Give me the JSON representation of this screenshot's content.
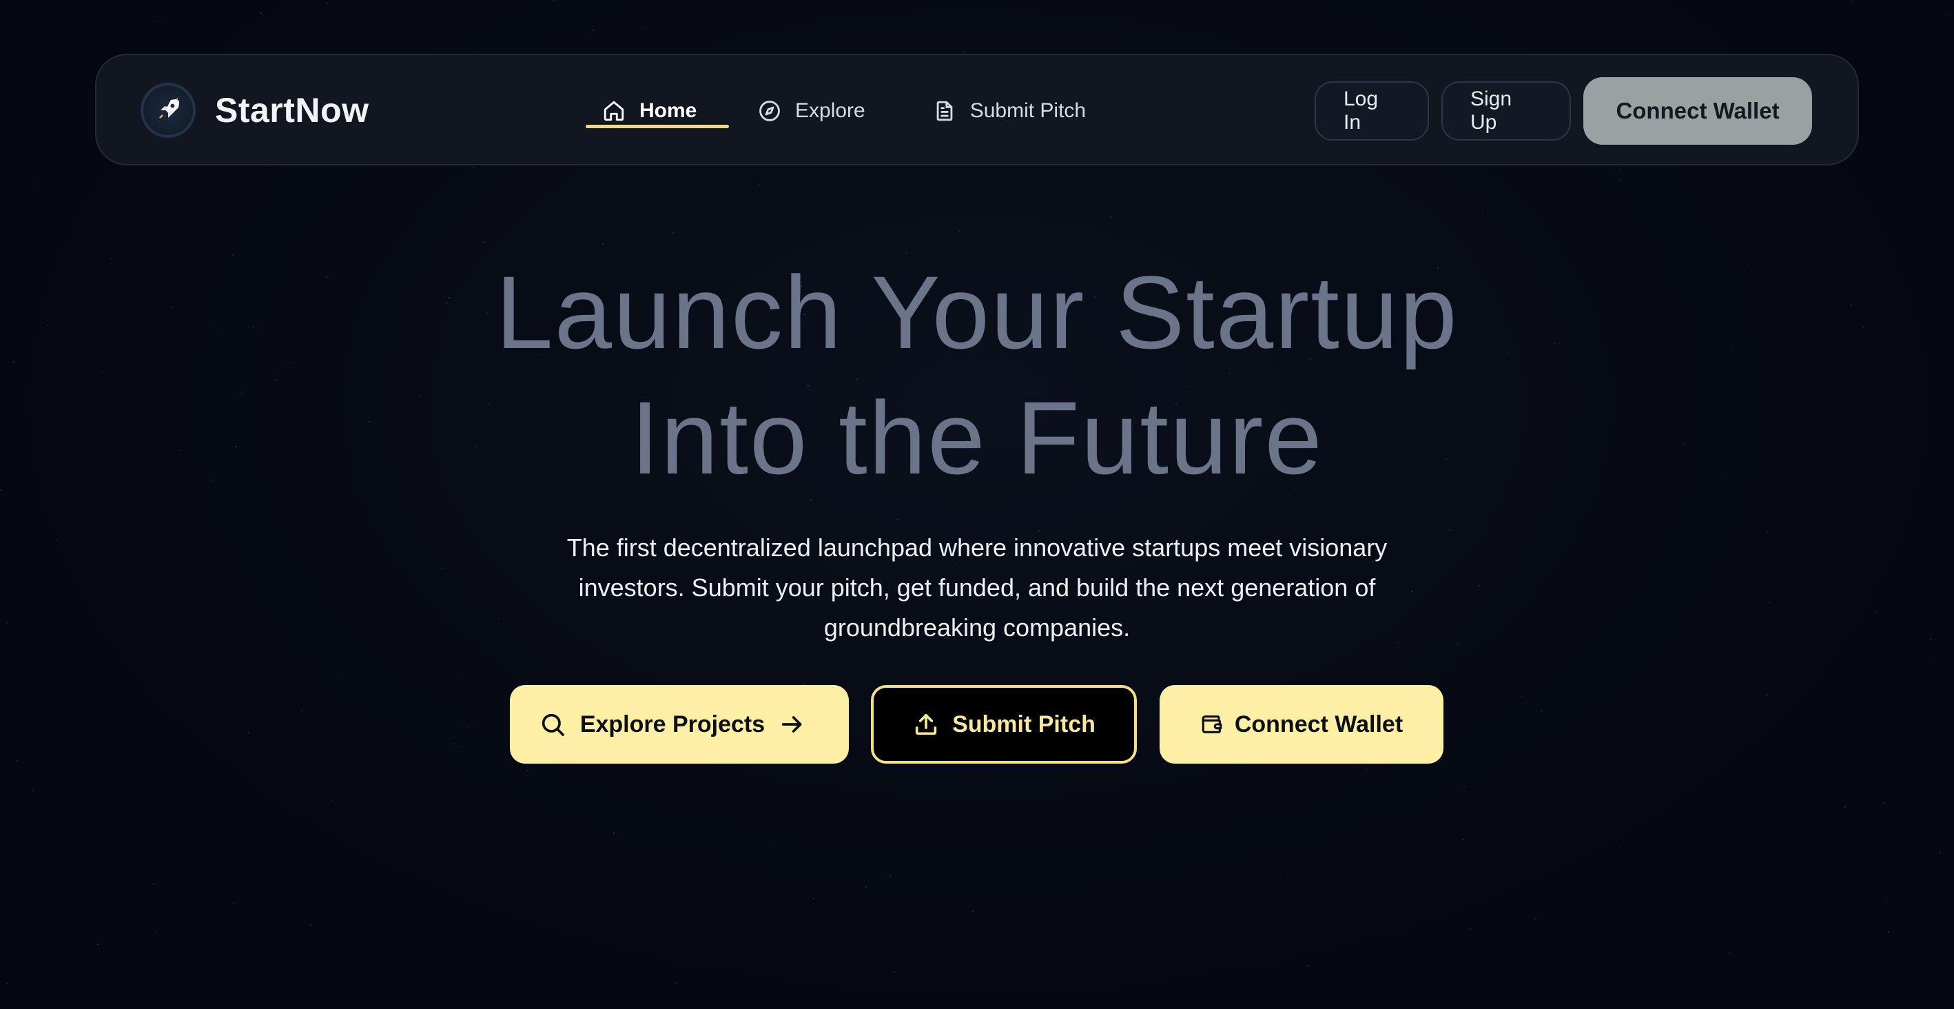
{
  "brand": {
    "name": "StartNow",
    "logo_icon": "rocket-icon"
  },
  "nav": {
    "items": [
      {
        "label": "Home",
        "icon": "home-icon",
        "active": true
      },
      {
        "label": "Explore",
        "icon": "compass-icon",
        "active": false
      },
      {
        "label": "Submit Pitch",
        "icon": "document-icon",
        "active": false
      }
    ],
    "actions": {
      "login": "Log In",
      "signup": "Sign Up",
      "wallet": "Connect Wallet"
    }
  },
  "hero": {
    "title_line1": "Launch Your Startup",
    "title_line2": "Into the Future",
    "subtitle": "The first decentralized launchpad where innovative startups meet visionary investors. Submit your pitch, get funded, and build the next generation of groundbreaking companies."
  },
  "cta": {
    "explore": "Explore Projects",
    "submit": "Submit Pitch",
    "wallet": "Connect Wallet"
  },
  "colors": {
    "background": "#060912",
    "accent": "#fdefa6",
    "active_underline": "#f2d98a",
    "title": "#6b7488"
  }
}
